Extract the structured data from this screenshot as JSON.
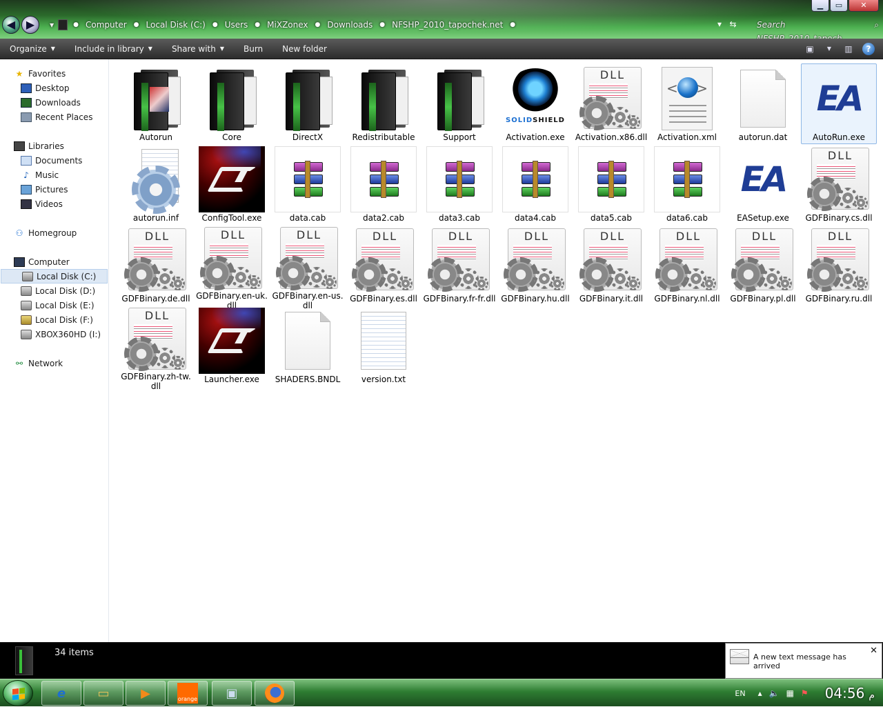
{
  "address": {
    "crumbs": [
      "Computer",
      "Local Disk (C:)",
      "Users",
      "MiXZonex",
      "Downloads",
      "NFSHP_2010_tapochek.net"
    ],
    "search_placeholder": "Search NFSHP_2010_tapoch...",
    "sep_glyph": "●"
  },
  "window": {
    "min": "▁",
    "max": "▭",
    "close": "✕"
  },
  "toolbar": {
    "organize": "Organize",
    "include_in_library": "Include in library",
    "share_with": "Share with",
    "burn": "Burn",
    "new_folder": "New folder",
    "caret": "▼",
    "help": "?"
  },
  "sidebar": {
    "favorites": "Favorites",
    "desktop": "Desktop",
    "downloads": "Downloads",
    "recent_places": "Recent Places",
    "libraries": "Libraries",
    "documents": "Documents",
    "music": "Music",
    "pictures": "Pictures",
    "videos": "Videos",
    "homegroup": "Homegroup",
    "computer": "Computer",
    "disk_c": "Local Disk (C:)",
    "disk_d": "Local Disk (D:)",
    "disk_e": "Local Disk (E:)",
    "disk_f": "Local Disk (F:)",
    "xbox": "XBOX360HD (I:)",
    "network": "Network"
  },
  "files": [
    {
      "name": "Autorun",
      "icon": "folder-icon"
    },
    {
      "name": "Core",
      "icon": "folder-icon"
    },
    {
      "name": "DirectX",
      "icon": "folder-icon"
    },
    {
      "name": "Redistributable",
      "icon": "folder-icon"
    },
    {
      "name": "Support",
      "icon": "folder-icon"
    },
    {
      "name": "Activation.exe",
      "icon": "solidshield-icon",
      "brand_a": "SOLID",
      "brand_b": "SHIELD"
    },
    {
      "name": "Activation.x86.dll",
      "icon": "dll-icon"
    },
    {
      "name": "Activation.xml",
      "icon": "xml-icon"
    },
    {
      "name": "autorun.dat",
      "icon": "blank-file-icon"
    },
    {
      "name": "AutoRun.exe",
      "icon": "ea-icon",
      "selected": true
    },
    {
      "name": "autorun.inf",
      "icon": "settings-file-icon"
    },
    {
      "name": "ConfigTool.exe",
      "icon": "nfs-icon"
    },
    {
      "name": "data.cab",
      "icon": "archive-icon"
    },
    {
      "name": "data2.cab",
      "icon": "archive-icon"
    },
    {
      "name": "data3.cab",
      "icon": "archive-icon"
    },
    {
      "name": "data4.cab",
      "icon": "archive-icon"
    },
    {
      "name": "data5.cab",
      "icon": "archive-icon"
    },
    {
      "name": "data6.cab",
      "icon": "archive-icon"
    },
    {
      "name": "EASetup.exe",
      "icon": "ea-icon"
    },
    {
      "name": "GDFBinary.cs.dll",
      "icon": "dll-icon"
    },
    {
      "name": "GDFBinary.de.dll",
      "icon": "dll-icon"
    },
    {
      "name": "GDFBinary.en-uk.dll",
      "icon": "dll-icon"
    },
    {
      "name": "GDFBinary.en-us.dll",
      "icon": "dll-icon"
    },
    {
      "name": "GDFBinary.es.dll",
      "icon": "dll-icon"
    },
    {
      "name": "GDFBinary.fr-fr.dll",
      "icon": "dll-icon"
    },
    {
      "name": "GDFBinary.hu.dll",
      "icon": "dll-icon"
    },
    {
      "name": "GDFBinary.it.dll",
      "icon": "dll-icon"
    },
    {
      "name": "GDFBinary.nl.dll",
      "icon": "dll-icon"
    },
    {
      "name": "GDFBinary.pl.dll",
      "icon": "dll-icon"
    },
    {
      "name": "GDFBinary.ru.dll",
      "icon": "dll-icon"
    },
    {
      "name": "GDFBinary.zh-tw.dll",
      "icon": "dll-icon"
    },
    {
      "name": "Launcher.exe",
      "icon": "nfs-icon"
    },
    {
      "name": "SHADERS.BNDL",
      "icon": "blank-file-icon"
    },
    {
      "name": "version.txt",
      "icon": "text-file-icon"
    }
  ],
  "dll_text": "DLL",
  "ea_text": "EA",
  "status": {
    "count": "34 items"
  },
  "toast": {
    "message": "A new text message has arrived",
    "close": "✕"
  },
  "taskbar": {
    "lang": "EN",
    "clock": "04:56",
    "ampm": "م",
    "orange_label": "orange"
  },
  "colors": {
    "accent_green": "#2e7d32",
    "ea_blue": "#1f3d95",
    "selection": "#eaf3fd"
  }
}
